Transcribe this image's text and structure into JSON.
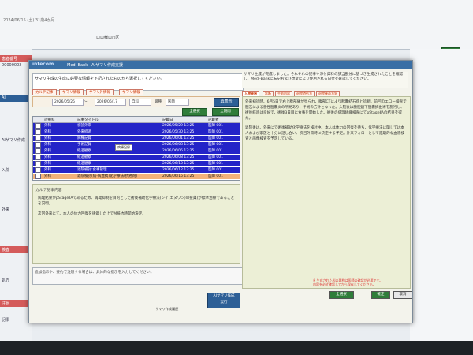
{
  "background": {
    "date_line": "2024/06/15 (土) 31歳4か月",
    "center_label": "ロロ様ロ○区",
    "left_rows": [
      "患者番号",
      "00000002",
      "AI",
      "AIサマリ作成",
      "入院",
      "外来",
      "検査",
      "処方",
      "注射",
      "記事"
    ]
  },
  "dialog": {
    "logo": "intecom",
    "title": "Medi-Bank - AIサマリ作成支援",
    "instruction": "サマリ生成の生成に必要な情報を下記されたものから選択してください。",
    "filter_tabs": [
      "カルテ記事",
      "サマリ情報",
      "サマリ外情報",
      "サマリ情報"
    ],
    "date_from": "2026/05/25",
    "date_tilde": "〜",
    "date_to": "2026/06/17",
    "dept": "自科",
    "author_label": "職種",
    "author_value": "医師",
    "search_button": "再表示",
    "all_button": "全選択",
    "period_button": "全期間",
    "table": {
      "headers": [
        "診療科",
        "記事タイトル",
        "記載日",
        "記載者"
      ],
      "rows": [
        {
          "dept": "外科",
          "title": "初診外来",
          "date": "2026/05/29 13:25",
          "author": "医師 001"
        },
        {
          "dept": "外科",
          "title": "外来経過",
          "date": "2026/05/30 13:25",
          "author": "医師 001"
        },
        {
          "dept": "外科",
          "title": "病棟記録",
          "date": "2026/06/01 13:25",
          "author": "医師 001"
        },
        {
          "dept": "外科",
          "title": "手術記録",
          "date": "2026/06/03 13:25",
          "author": "医師 001"
        },
        {
          "dept": "外科",
          "title": "経過観察",
          "date": "2026/06/05 13:25",
          "author": "医師 001"
        },
        {
          "dept": "外科",
          "title": "経過観察",
          "date": "2026/06/08 13:25",
          "author": "医師 001"
        },
        {
          "dept": "外科",
          "title": "経過観察",
          "date": "2026/06/10 13:25",
          "author": "医師 001"
        },
        {
          "dept": "外科",
          "title": "退院検討:食事管理",
          "date": "2026/06/12 13:25",
          "author": "医師 001"
        },
        {
          "dept": "外科",
          "title": "退院検討(病-病連携)化学療法(抗癌剤)",
          "date": "2026/06/15 13:25",
          "author": "医師 001"
        }
      ],
      "tooltip": "病棟記録"
    },
    "content_header": "カルテ記事内容",
    "content_body": [
      "病理結果がpStageⅡAであるため、再発抑制を目的とした術後補助化学療法(シイ(エヌワン)の投薬)が標準治療であることを説明。",
      "次回外来にて、本人の体力回復を評価した上でM抵抗時開始決定。"
    ],
    "note_text": "追加指示や、要約で注釈する場合は、具体的な指示を入力してください。",
    "run_button": [
      "AIサマリ作成",
      "実行"
    ],
    "history_label": "サマリ作成履歴"
  },
  "result": {
    "header": "サマリ生成が完成しました。それぞれの記事や添付資料の該当部分に基づき生成されたことを確認し、Medi-Bankに転記および改変により使用される日付を確認してください。",
    "tabs": [
      "入院経過",
      "診断",
      "手術内容",
      "退院時処方",
      "退院後の方針"
    ],
    "summary": [
      "外来初診時、6月5日で右上腹部痛が見られ、腹部CTにより胆嚢結石症と診断。前回のエコー検査で胆石による急性胆嚢炎の所見あり、手術の方針となった。入院後は腹腔鏡下胆嚢摘出術を施行し、術後経過は良好で、術後3日目に食事を開始した。術後の病理組織検査にてpStageⅡAの結果を得た。",
      "退院後は、外来にて術後補助化学療法を検討中。本人は体力の回復を待ち、化学療法に関しては本人および家族と十分に話し合い、次回外来時に決定する予定。外来フォローとして定期的な血液検査と画像検査を予定している。"
    ],
    "warning": "※ 生成されたAIの要約は医師の確認が必要です。内容を必ず確認してから保存してください。",
    "edit_button": "全選択",
    "ok_button": "確定",
    "cancel_button": "取消"
  },
  "colors": {
    "selected_row": "#2424c8",
    "alt_row": "#f2b27a",
    "accent": "#2d5f96",
    "green": "#2f7d3a"
  }
}
